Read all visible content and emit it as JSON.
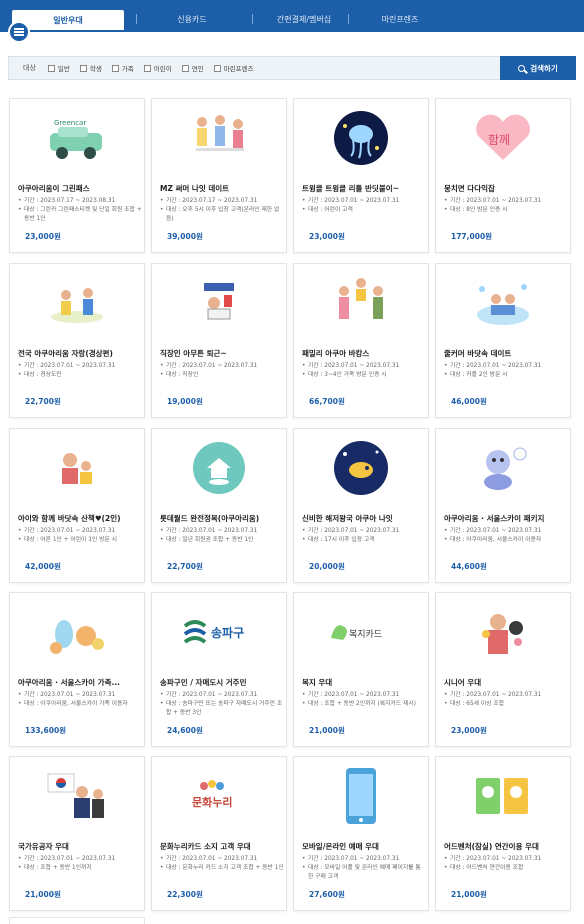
{
  "tabs": [
    {
      "label": "일반우대",
      "active": true
    },
    {
      "label": "신용카드",
      "active": false
    },
    {
      "label": "간편결제/멤버십",
      "active": false
    },
    {
      "label": "마린프렌즈",
      "active": false
    }
  ],
  "filter": {
    "label": "대상",
    "options": [
      "일반",
      "학생",
      "가족",
      "어린이",
      "연인",
      "마린프렌즈"
    ],
    "search_label": "검색하기"
  },
  "cards": [
    {
      "title": "아쿠아리움이 그린패스",
      "period": "기간 : 2023.07.17 ~ 2023.08.31",
      "target": "대상 : 그린카 그린패스티켓 및 단일 회원 조합 + 동반 1인",
      "price": "23,000원",
      "icon": "green-car-icon"
    },
    {
      "title": "MZ 써머 나잇 데이트",
      "period": "기간 : 2023.07.17 ~ 2023.07.31",
      "target": "대상 : 오후 5시 이후 입장 고객(온라인 제한 없음)",
      "price": "39,000원",
      "icon": "dancing-people-icon"
    },
    {
      "title": "트윙클 트윙클 리틀 반딧불이~",
      "period": "기간 : 2023.07.01 ~ 2023.07.31",
      "target": "대상 : 어린이 고객",
      "price": "23,000원",
      "icon": "firefly-jellyfish-icon"
    },
    {
      "title": "뭉치면 다다익잡",
      "period": "기간 : 2023.07.01 ~ 2023.07.31",
      "target": "대상 : 8인 방문 인증 시",
      "price": "177,000원",
      "icon": "together-heart-icon"
    },
    {
      "title": "전국 아쿠아리움 자랑(경상편)",
      "period": "기간 : 2023.07.01 ~ 2023.07.31",
      "target": "대상 : 경상도민",
      "price": "22,700원",
      "icon": "map-tour-icon"
    },
    {
      "title": "직장인 아무튼 퇴근~",
      "period": "기간 : 2023.07.01 ~ 2023.07.31",
      "target": "대상 : 직장인",
      "price": "19,000원",
      "icon": "office-worker-icon"
    },
    {
      "title": "패밀리 아쿠아 바캉스",
      "period": "기간 : 2023.07.01 ~ 2023.07.31",
      "target": "대상 : 3~4인 가족 방문 인증 시",
      "price": "66,700원",
      "icon": "family-icon"
    },
    {
      "title": "줄커머 바닷속 데이트",
      "period": "기간 : 2023.07.01 ~ 2023.07.31",
      "target": "대상 : 커플 2인 방문 시",
      "price": "46,000원",
      "icon": "couple-sea-icon"
    },
    {
      "title": "아이와 함께 바닷속 산책♥(2인)",
      "period": "기간 : 2023.07.01 ~ 2023.07.31",
      "target": "대상 : 어른 1인 + 어린이 1인 방문 시",
      "price": "42,000원",
      "icon": "child-parent-icon"
    },
    {
      "title": "롯데월드 완전정복(아쿠아리움)",
      "period": "기간 : 2023.07.01 ~ 2023.07.31",
      "target": "대상 : 일년 회원권 조합 + 동반 1인",
      "price": "22,700원",
      "icon": "lotteworld-badge-icon"
    },
    {
      "title": "신비한 해저왕국 아쿠아 나잇",
      "period": "기간 : 2023.07.01 ~ 2023.07.31",
      "target": "대상 : 17시 이후 입장 고객",
      "price": "20,000원",
      "icon": "night-fish-icon"
    },
    {
      "title": "아쿠아리움 · 서울스카이 패키지",
      "period": "기간 : 2023.07.01 ~ 2023.07.31",
      "target": "대상 : 아쿠아리움, 서울스카이 이용자",
      "price": "44,600원",
      "icon": "mascot-icon"
    },
    {
      "title": "아쿠아리움 · 서울스카이 가족...",
      "period": "기간 : 2023.07.01 ~ 2023.07.31",
      "target": "대상 : 아쿠아리움, 서울스카이 가족 이용자",
      "price": "133,600원",
      "icon": "mascot-family-icon"
    },
    {
      "title": "송파구민 / 자매도시 거주민",
      "period": "기간 : 2023.07.01 ~ 2023.07.31",
      "target": "대상 : 송파구민 또는 송파구 자매도시 거주민 조합 + 동반 3인",
      "price": "24,600원",
      "icon": "songpa-logo-icon"
    },
    {
      "title": "복지 우대",
      "period": "기간 : 2023.07.01 ~ 2023.07.31",
      "target": "대상 : 조합 + 동반 2인까지 (복지카드 제시)",
      "price": "21,000원",
      "icon": "welfare-card-icon"
    },
    {
      "title": "시니어 우대",
      "period": "기간 : 2023.07.01 ~ 2023.07.31",
      "target": "대상 : 65세 이상 조합",
      "price": "23,000원",
      "icon": "senior-icon"
    },
    {
      "title": "국가유공자 우대",
      "period": "기간 : 2023.07.01 ~ 2023.07.31",
      "target": "대상 : 조합 + 동반 1인까지",
      "price": "21,000원",
      "icon": "patriot-flag-icon"
    },
    {
      "title": "문화누리카드 소지 고객 우대",
      "period": "기간 : 2023.07.01 ~ 2023.07.31",
      "target": "대상 : 문화누리 카드 소지 고객 조합 + 동반 1인",
      "price": "22,300원",
      "icon": "culture-card-icon"
    },
    {
      "title": "모바일/온라인 예매 우대",
      "period": "기간 : 2023.07.01 ~ 2023.07.31",
      "target": "대상 : 모바일 어플 및 온라인 예매 페이지를 통한 구매 고객",
      "price": "27,600원",
      "icon": "mobile-phone-icon"
    },
    {
      "title": "어드벤처(잠실) 연간이용 우대",
      "period": "기간 : 2023.07.01 ~ 2023.07.31",
      "target": "대상 : 어드벤처 연간이용 조합",
      "price": "21,000원",
      "icon": "annual-pass-icon"
    }
  ],
  "logos": {
    "greencar": "Greencar",
    "songpa": "송파구",
    "welfare": "복지카드",
    "culture": "문화누리"
  },
  "colors": {
    "primary": "#1d5ea9",
    "price": "#1d5ea9"
  }
}
